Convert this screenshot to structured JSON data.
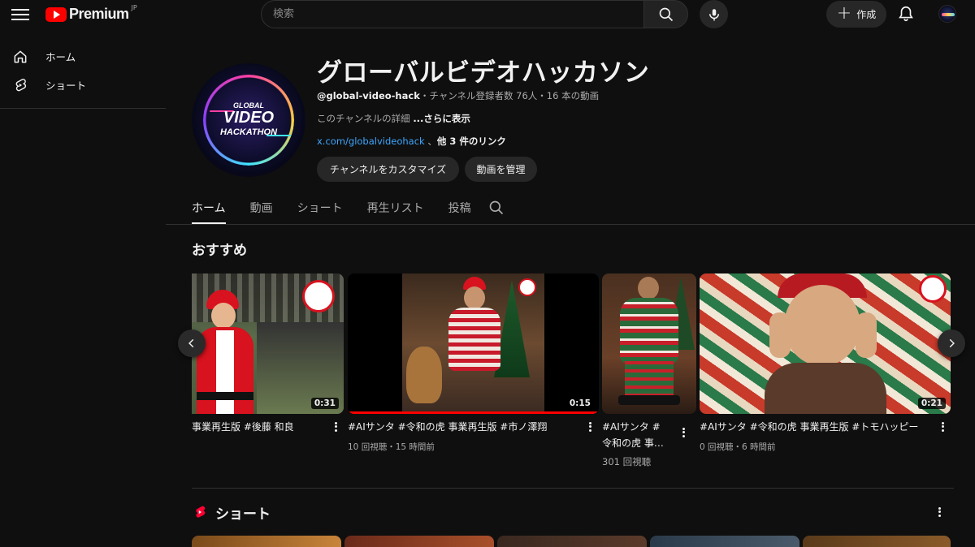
{
  "header": {
    "brand": "Premium",
    "region": "JP",
    "search_placeholder": "検索",
    "create_label": "作成"
  },
  "sidebar": {
    "items": [
      {
        "label": "ホーム",
        "icon": "home-icon"
      },
      {
        "label": "ショート",
        "icon": "shorts-icon"
      }
    ]
  },
  "channel": {
    "title": "グローバルビデオハッカソン",
    "handle": "@global-video-hack",
    "stats": "・チャンネル登録者数 76人・16 本の動画",
    "desc": "このチャンネルの詳細 ",
    "more": "...さらに表示",
    "link": "x.com/globalvideohack",
    "link_sep": " 、",
    "link_others": "他 3 件のリンク",
    "avatar_text": [
      "GLOBAL",
      "VIDEO",
      "HACKATHON"
    ],
    "buttons": {
      "customize": "チャンネルをカスタマイズ",
      "manage": "動画を管理"
    }
  },
  "tabs": [
    "ホーム",
    "動画",
    "ショート",
    "再生リスト",
    "投稿"
  ],
  "recommended": {
    "title": "おすすめ",
    "videos": [
      {
        "title": "事業再生版 #後藤 和良",
        "duration": "0:31",
        "meta": ""
      },
      {
        "title": "#AIサンタ #令和の虎 事業再生版 #市ノ澤翔",
        "duration": "0:15",
        "meta": "10 回視聴・15 時間前"
      },
      {
        "title": "#AIサンタ #",
        "title2": "令和の虎 事…",
        "duration": "",
        "meta": "301 回視聴"
      },
      {
        "title": "#AIサンタ #令和の虎 事業再生版 #トモハッピー",
        "duration": "0:21",
        "meta": "0 回視聴・6 時間前"
      }
    ]
  },
  "shorts": {
    "title": "ショート"
  },
  "colors": {
    "background": "#0f0f0f",
    "brand_red": "#ff0000",
    "link": "#3ea6ff",
    "surface": "#272727"
  }
}
